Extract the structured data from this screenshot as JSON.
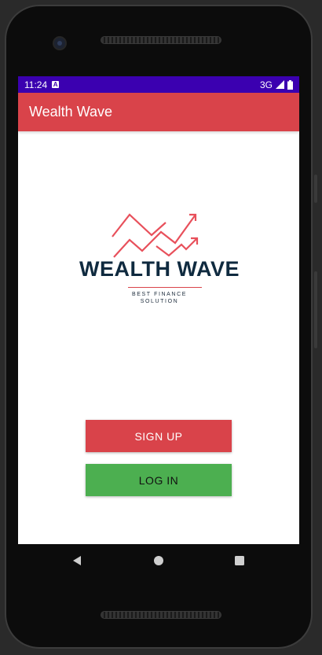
{
  "status_bar": {
    "time": "11:24",
    "notification_icon": "a-letter-icon",
    "network": "3G",
    "signal_icon": "signal-icon",
    "battery_icon": "battery-icon"
  },
  "app_bar": {
    "title": "Wealth Wave"
  },
  "logo": {
    "wordmark": "WEALTH WAVE",
    "tagline_line1": "BEST FINANCE",
    "tagline_line2": "SOLUTION"
  },
  "actions": {
    "signup_label": "SIGN UP",
    "login_label": "LOG IN"
  },
  "nav": {
    "back_icon": "back-triangle-icon",
    "home_icon": "home-circle-icon",
    "recents_icon": "recents-square-icon"
  },
  "colors": {
    "status_bar": "#3b00b0",
    "app_bar": "#d9434a",
    "signup_button": "#d9434a",
    "login_button": "#4caf50",
    "logo_text": "#0f2a3f",
    "logo_accent": "#e8505b"
  }
}
